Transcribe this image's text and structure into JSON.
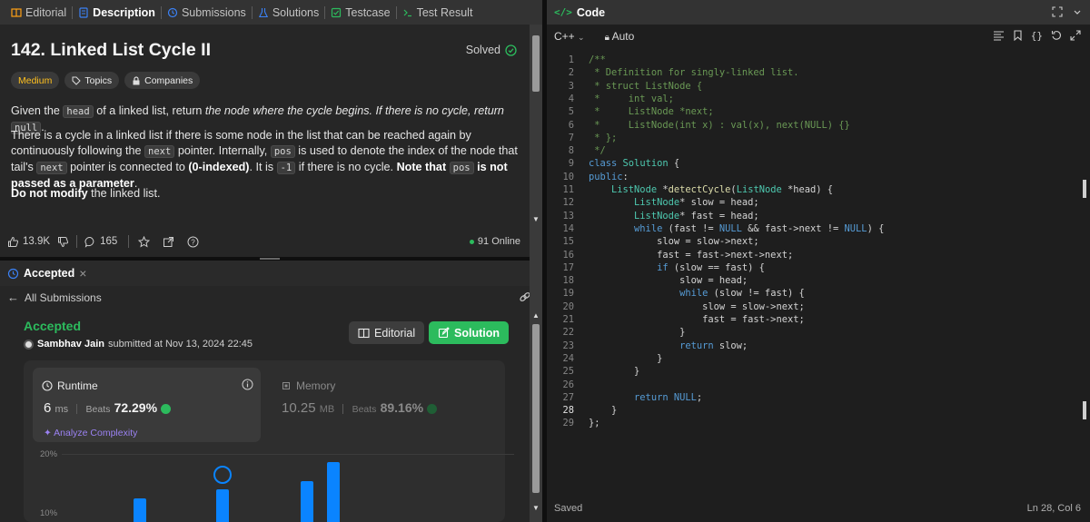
{
  "tabs": {
    "editorial": "Editorial",
    "description": "Description",
    "submissions": "Submissions",
    "solutions": "Solutions",
    "testcase": "Testcase",
    "test_result": "Test Result"
  },
  "problem": {
    "title": "142. Linked List Cycle II",
    "status": "Solved",
    "difficulty": "Medium",
    "topics": "Topics",
    "companies": "Companies",
    "p1_a": "Given the",
    "p1_code": "head",
    "p1_b": "of a linked list, return",
    "p1_i": "the node where the cycle begins. If there is no cycle, return",
    "p1_code2": "null",
    "p1_end": ".",
    "p2_a": "There is a cycle in a linked list if there is some node in the list that can be reached again by continuously following the",
    "p2_code1": "next",
    "p2_b": "pointer. Internally,",
    "p2_code2": "pos",
    "p2_c": "is used to denote the index of the node that tail's",
    "p2_code3": "next",
    "p2_d": "pointer is connected to",
    "p2_bold1": "(0-indexed)",
    "p2_e": ". It is",
    "p2_code4": "-1",
    "p2_f": "if there is no cycle.",
    "p2_bold2": "Note that",
    "p2_code5": "pos",
    "p2_bold3": "is not passed as a parameter",
    "p2_end": ".",
    "p3": "Do not modify",
    "p3_b": "the linked list."
  },
  "stats": {
    "likes": "13.9K",
    "comments": "165",
    "online": "91 Online"
  },
  "submission": {
    "tab_label": "Accepted",
    "back": "All Submissions",
    "result": "Accepted",
    "author": "Sambhav Jain",
    "submitted_at": "submitted at Nov 13, 2024 22:45",
    "editorial_btn": "Editorial",
    "solution_btn": "Solution",
    "runtime_label": "Runtime",
    "runtime_value": "6",
    "runtime_unit": "ms",
    "beats_label": "Beats",
    "runtime_beats": "72.29%",
    "analyze": "Analyze Complexity",
    "memory_label": "Memory",
    "memory_value": "10.25",
    "memory_unit": "MB",
    "memory_beats": "89.16%",
    "axis_20": "20%",
    "axis_10": "10%"
  },
  "editor": {
    "title": "Code",
    "language": "C++",
    "mode": "Auto",
    "status_left": "Saved",
    "cursor": "Ln 28, Col 6",
    "lines": [
      "/**",
      " * Definition for singly-linked list.",
      " * struct ListNode {",
      " *     int val;",
      " *     ListNode *next;",
      " *     ListNode(int x) : val(x), next(NULL) {}",
      " * };",
      " */",
      "class Solution {",
      "public:",
      "    ListNode *detectCycle(ListNode *head) {",
      "        ListNode* slow = head;",
      "        ListNode* fast = head;",
      "        while (fast != NULL && fast->next != NULL) {",
      "            slow = slow->next;",
      "            fast = fast->next->next;",
      "            if (slow == fast) {",
      "                slow = head;",
      "                while (slow != fast) {",
      "                    slow = slow->next;",
      "                    fast = fast->next;",
      "                }",
      "                return slow;",
      "            }",
      "        }",
      "",
      "        return NULL;",
      "    }",
      "};"
    ]
  },
  "colors": {
    "accent_green": "#2cbb5d",
    "medium": "#ffc01e",
    "bar_blue": "#0a84ff"
  }
}
